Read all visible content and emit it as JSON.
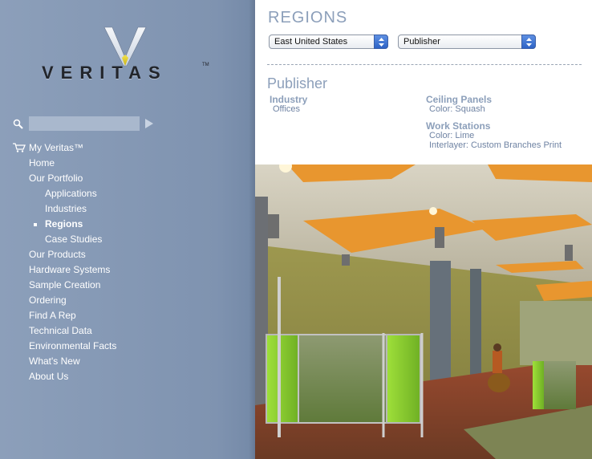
{
  "logo": {
    "wordmark": "VERITAS",
    "tm": "TM"
  },
  "search": {
    "placeholder": ""
  },
  "nav": {
    "my_veritas": "My Veritas™",
    "items": [
      {
        "label": "Home"
      },
      {
        "label": "Our Portfolio"
      },
      {
        "label": "Applications"
      },
      {
        "label": "Industries"
      },
      {
        "label": "Regions",
        "active": true
      },
      {
        "label": "Case Studies"
      },
      {
        "label": "Our Products"
      },
      {
        "label": "Hardware Systems"
      },
      {
        "label": "Sample Creation"
      },
      {
        "label": "Ordering"
      },
      {
        "label": "Find A Rep"
      },
      {
        "label": "Technical Data"
      },
      {
        "label": "Environmental Facts"
      },
      {
        "label": "What's New"
      },
      {
        "label": "About Us"
      }
    ]
  },
  "main": {
    "title": "REGIONS",
    "region_select": "East United States",
    "industry_select": "Publisher",
    "section_title": "Publisher",
    "industry": {
      "heading": "Industry",
      "value": "Offices"
    },
    "ceiling_panels": {
      "heading": "Ceiling Panels",
      "color": "Color: Squash"
    },
    "work_stations": {
      "heading": "Work Stations",
      "color": "Color: Lime",
      "interlayer": "Interlayer: Custom Branches Print"
    }
  },
  "colors": {
    "sidebar": "#8c9fba",
    "accent_text": "#8c9fba",
    "ceiling_panel": "#e8962f",
    "workstation_panel": "#8fd02f"
  }
}
